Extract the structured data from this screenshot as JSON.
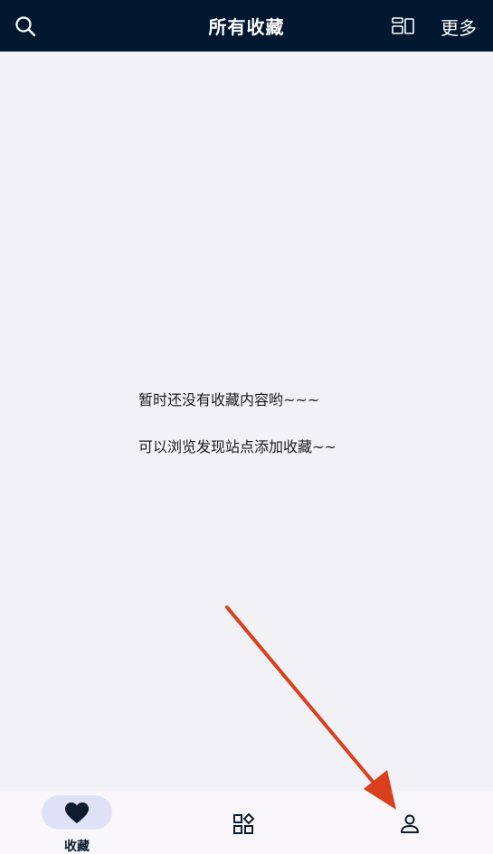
{
  "header": {
    "title": "所有收藏",
    "more_label": "更多",
    "icons": {
      "search": "search-icon",
      "layout": "layout-toggle-icon"
    }
  },
  "empty_state": {
    "line1": "暂时还没有收藏内容哟~~~",
    "line2": "可以浏览发现站点添加收藏~~"
  },
  "bottom_nav": {
    "items": [
      {
        "label": "收藏",
        "icon": "heart-icon",
        "active": true
      },
      {
        "label": "",
        "icon": "grid-icon",
        "active": false
      },
      {
        "label": "",
        "icon": "person-icon",
        "active": false
      }
    ]
  },
  "colors": {
    "header_bg": "#001730",
    "page_bg": "#f2f2f6",
    "active_pill": "#dfe2f6",
    "arrow": "#d9401e"
  }
}
